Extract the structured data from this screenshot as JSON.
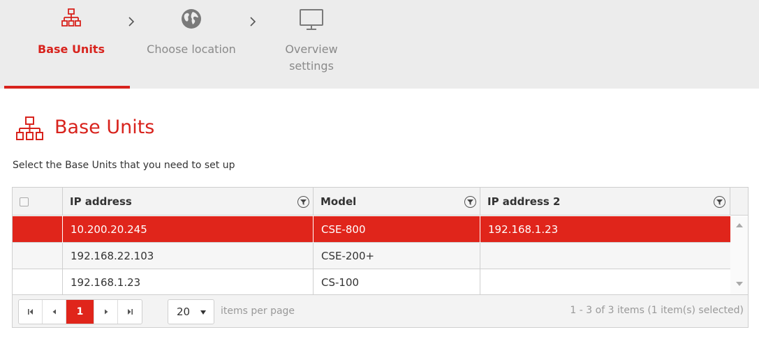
{
  "wizard": {
    "steps": [
      {
        "label": "Base Units",
        "icon": "network-icon",
        "active": true
      },
      {
        "label": "Choose location",
        "icon": "globe-icon",
        "active": false
      },
      {
        "label": "Overview\nsettings",
        "icon": "monitor-icon",
        "active": false
      }
    ],
    "separator": ">"
  },
  "page": {
    "title": "Base Units",
    "subtitle": "Select the Base Units that you need to set up"
  },
  "grid": {
    "columns": [
      "IP address",
      "Model",
      "IP address 2"
    ],
    "rows": [
      {
        "ip": "10.200.20.245",
        "model": "CSE-800",
        "ip2": "192.168.1.23",
        "selected": true
      },
      {
        "ip": "192.168.22.103",
        "model": "CSE-200+",
        "ip2": "",
        "selected": false
      },
      {
        "ip": "192.168.1.23",
        "model": "CS-100",
        "ip2": "",
        "selected": false
      }
    ]
  },
  "pager": {
    "current_page": "1",
    "page_size": "20",
    "items_per_page_label": "items per page",
    "info": "1 - 3 of 3 items (1 item(s) selected)"
  },
  "colors": {
    "accent": "#d8231d",
    "selected_row": "#e0251b",
    "header_bg": "#ececec"
  }
}
